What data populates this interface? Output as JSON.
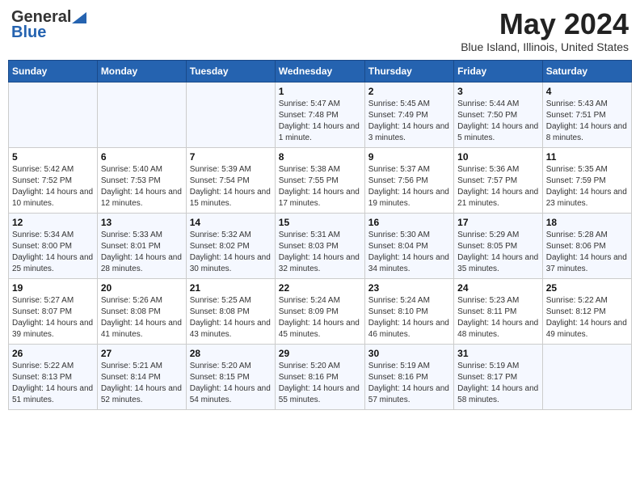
{
  "header": {
    "logo_general": "General",
    "logo_blue": "Blue",
    "month_title": "May 2024",
    "location": "Blue Island, Illinois, United States"
  },
  "days_of_week": [
    "Sunday",
    "Monday",
    "Tuesday",
    "Wednesday",
    "Thursday",
    "Friday",
    "Saturday"
  ],
  "weeks": [
    [
      {
        "num": "",
        "sunrise": "",
        "sunset": "",
        "daylight": ""
      },
      {
        "num": "",
        "sunrise": "",
        "sunset": "",
        "daylight": ""
      },
      {
        "num": "",
        "sunrise": "",
        "sunset": "",
        "daylight": ""
      },
      {
        "num": "1",
        "sunrise": "Sunrise: 5:47 AM",
        "sunset": "Sunset: 7:48 PM",
        "daylight": "Daylight: 14 hours and 1 minute."
      },
      {
        "num": "2",
        "sunrise": "Sunrise: 5:45 AM",
        "sunset": "Sunset: 7:49 PM",
        "daylight": "Daylight: 14 hours and 3 minutes."
      },
      {
        "num": "3",
        "sunrise": "Sunrise: 5:44 AM",
        "sunset": "Sunset: 7:50 PM",
        "daylight": "Daylight: 14 hours and 5 minutes."
      },
      {
        "num": "4",
        "sunrise": "Sunrise: 5:43 AM",
        "sunset": "Sunset: 7:51 PM",
        "daylight": "Daylight: 14 hours and 8 minutes."
      }
    ],
    [
      {
        "num": "5",
        "sunrise": "Sunrise: 5:42 AM",
        "sunset": "Sunset: 7:52 PM",
        "daylight": "Daylight: 14 hours and 10 minutes."
      },
      {
        "num": "6",
        "sunrise": "Sunrise: 5:40 AM",
        "sunset": "Sunset: 7:53 PM",
        "daylight": "Daylight: 14 hours and 12 minutes."
      },
      {
        "num": "7",
        "sunrise": "Sunrise: 5:39 AM",
        "sunset": "Sunset: 7:54 PM",
        "daylight": "Daylight: 14 hours and 15 minutes."
      },
      {
        "num": "8",
        "sunrise": "Sunrise: 5:38 AM",
        "sunset": "Sunset: 7:55 PM",
        "daylight": "Daylight: 14 hours and 17 minutes."
      },
      {
        "num": "9",
        "sunrise": "Sunrise: 5:37 AM",
        "sunset": "Sunset: 7:56 PM",
        "daylight": "Daylight: 14 hours and 19 minutes."
      },
      {
        "num": "10",
        "sunrise": "Sunrise: 5:36 AM",
        "sunset": "Sunset: 7:57 PM",
        "daylight": "Daylight: 14 hours and 21 minutes."
      },
      {
        "num": "11",
        "sunrise": "Sunrise: 5:35 AM",
        "sunset": "Sunset: 7:59 PM",
        "daylight": "Daylight: 14 hours and 23 minutes."
      }
    ],
    [
      {
        "num": "12",
        "sunrise": "Sunrise: 5:34 AM",
        "sunset": "Sunset: 8:00 PM",
        "daylight": "Daylight: 14 hours and 25 minutes."
      },
      {
        "num": "13",
        "sunrise": "Sunrise: 5:33 AM",
        "sunset": "Sunset: 8:01 PM",
        "daylight": "Daylight: 14 hours and 28 minutes."
      },
      {
        "num": "14",
        "sunrise": "Sunrise: 5:32 AM",
        "sunset": "Sunset: 8:02 PM",
        "daylight": "Daylight: 14 hours and 30 minutes."
      },
      {
        "num": "15",
        "sunrise": "Sunrise: 5:31 AM",
        "sunset": "Sunset: 8:03 PM",
        "daylight": "Daylight: 14 hours and 32 minutes."
      },
      {
        "num": "16",
        "sunrise": "Sunrise: 5:30 AM",
        "sunset": "Sunset: 8:04 PM",
        "daylight": "Daylight: 14 hours and 34 minutes."
      },
      {
        "num": "17",
        "sunrise": "Sunrise: 5:29 AM",
        "sunset": "Sunset: 8:05 PM",
        "daylight": "Daylight: 14 hours and 35 minutes."
      },
      {
        "num": "18",
        "sunrise": "Sunrise: 5:28 AM",
        "sunset": "Sunset: 8:06 PM",
        "daylight": "Daylight: 14 hours and 37 minutes."
      }
    ],
    [
      {
        "num": "19",
        "sunrise": "Sunrise: 5:27 AM",
        "sunset": "Sunset: 8:07 PM",
        "daylight": "Daylight: 14 hours and 39 minutes."
      },
      {
        "num": "20",
        "sunrise": "Sunrise: 5:26 AM",
        "sunset": "Sunset: 8:08 PM",
        "daylight": "Daylight: 14 hours and 41 minutes."
      },
      {
        "num": "21",
        "sunrise": "Sunrise: 5:25 AM",
        "sunset": "Sunset: 8:08 PM",
        "daylight": "Daylight: 14 hours and 43 minutes."
      },
      {
        "num": "22",
        "sunrise": "Sunrise: 5:24 AM",
        "sunset": "Sunset: 8:09 PM",
        "daylight": "Daylight: 14 hours and 45 minutes."
      },
      {
        "num": "23",
        "sunrise": "Sunrise: 5:24 AM",
        "sunset": "Sunset: 8:10 PM",
        "daylight": "Daylight: 14 hours and 46 minutes."
      },
      {
        "num": "24",
        "sunrise": "Sunrise: 5:23 AM",
        "sunset": "Sunset: 8:11 PM",
        "daylight": "Daylight: 14 hours and 48 minutes."
      },
      {
        "num": "25",
        "sunrise": "Sunrise: 5:22 AM",
        "sunset": "Sunset: 8:12 PM",
        "daylight": "Daylight: 14 hours and 49 minutes."
      }
    ],
    [
      {
        "num": "26",
        "sunrise": "Sunrise: 5:22 AM",
        "sunset": "Sunset: 8:13 PM",
        "daylight": "Daylight: 14 hours and 51 minutes."
      },
      {
        "num": "27",
        "sunrise": "Sunrise: 5:21 AM",
        "sunset": "Sunset: 8:14 PM",
        "daylight": "Daylight: 14 hours and 52 minutes."
      },
      {
        "num": "28",
        "sunrise": "Sunrise: 5:20 AM",
        "sunset": "Sunset: 8:15 PM",
        "daylight": "Daylight: 14 hours and 54 minutes."
      },
      {
        "num": "29",
        "sunrise": "Sunrise: 5:20 AM",
        "sunset": "Sunset: 8:16 PM",
        "daylight": "Daylight: 14 hours and 55 minutes."
      },
      {
        "num": "30",
        "sunrise": "Sunrise: 5:19 AM",
        "sunset": "Sunset: 8:16 PM",
        "daylight": "Daylight: 14 hours and 57 minutes."
      },
      {
        "num": "31",
        "sunrise": "Sunrise: 5:19 AM",
        "sunset": "Sunset: 8:17 PM",
        "daylight": "Daylight: 14 hours and 58 minutes."
      },
      {
        "num": "",
        "sunrise": "",
        "sunset": "",
        "daylight": ""
      }
    ]
  ]
}
